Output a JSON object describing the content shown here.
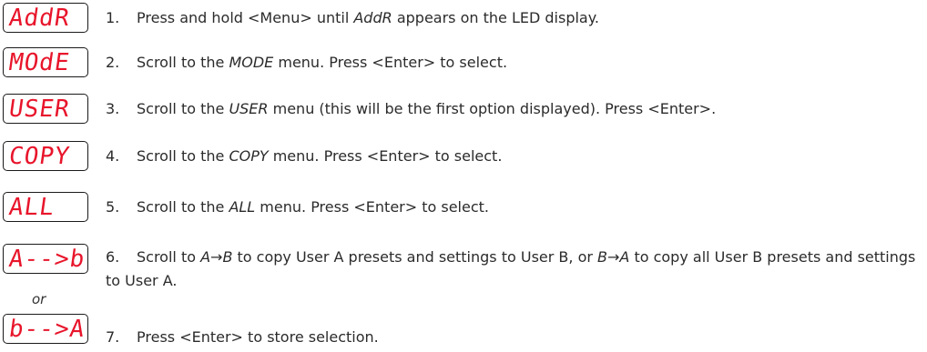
{
  "displays": [
    {
      "text": "AddR"
    },
    {
      "text": "MOdE"
    },
    {
      "text": "USER"
    },
    {
      "text": "COPY"
    },
    {
      "text": "ALL"
    },
    {
      "text": "A-->b"
    },
    {
      "text": "b-->A"
    }
  ],
  "or_label": "or",
  "steps": [
    {
      "num": "1.",
      "pre": "Press and hold <Menu> until ",
      "em": "AddR",
      "post": " appears on the LED display."
    },
    {
      "num": "2.",
      "pre": "Scroll to the ",
      "em": "MODE",
      "post": " menu. Press <Enter> to select."
    },
    {
      "num": "3.",
      "pre": "Scroll to the ",
      "em": "USER",
      "post": " menu (this will be the first option displayed). Press <Enter>."
    },
    {
      "num": "4.",
      "pre": "Scroll to the ",
      "em": "COPY",
      "post": " menu. Press <Enter> to select."
    },
    {
      "num": "5.",
      "pre": "Scroll to the ",
      "em": "ALL",
      "post": " menu. Press <Enter> to select."
    },
    {
      "num": "6.",
      "pre": "Scroll to ",
      "em": "A→B",
      "mid": " to copy User A presets and settings to User B, or ",
      "em2": "B→A",
      "post": " to copy all User B presets and settings to User A."
    },
    {
      "num": "7.",
      "pre": "Press <Enter> to store selection.",
      "em": "",
      "post": ""
    }
  ]
}
